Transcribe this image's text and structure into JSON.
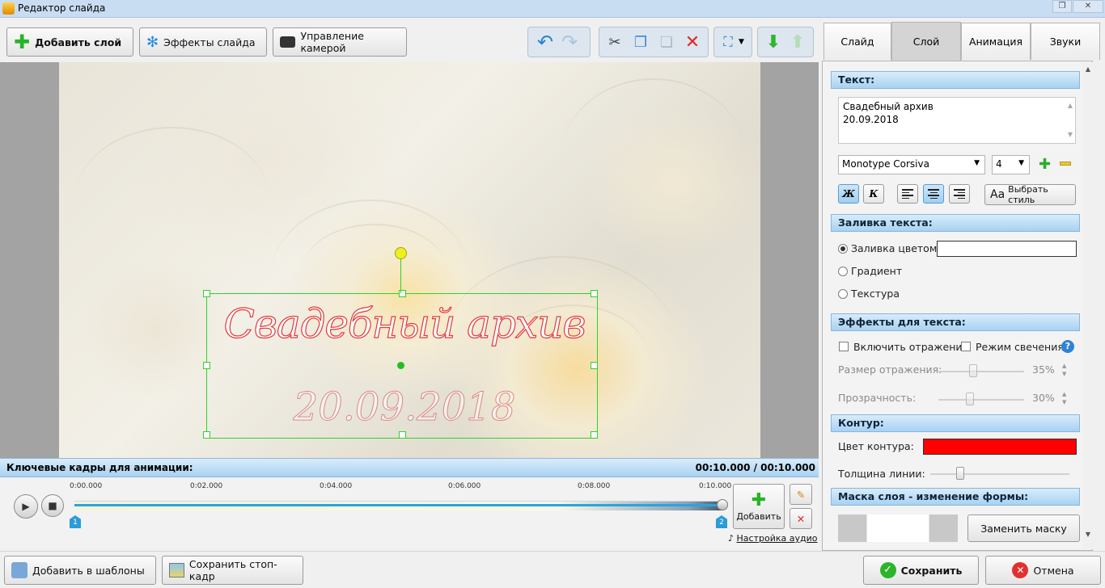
{
  "window": {
    "title": "Редактор слайда"
  },
  "toolbar": {
    "add_layer": "Добавить слой",
    "slide_effects": "Эффекты слайда",
    "camera": "Управление камерой"
  },
  "slide": {
    "line1": "Свадебный архив",
    "line2": "20.09.2018"
  },
  "keyframes": {
    "title": "Ключевые кадры для анимации:",
    "time": "00:10.000 / 00:10.000",
    "ticks": [
      "0:00.000",
      "0:02.000",
      "0:04.000",
      "0:06.000",
      "0:08.000",
      "0:10.000"
    ],
    "marker1": "1",
    "marker2": "2",
    "add": "Добавить",
    "audio_settings": "Настройка аудио"
  },
  "bottom": {
    "add_templates": "Добавить в шаблоны",
    "save_frame": "Сохранить стоп-кадр",
    "save": "Сохранить",
    "cancel": "Отмена"
  },
  "tabs": [
    "Слайд",
    "Слой",
    "Анимация",
    "Звуки"
  ],
  "panel": {
    "text_section": "Текст:",
    "text_line1": "Свадебный архив",
    "text_line2": "20.09.2018",
    "font": "Monotype Corsiva",
    "size": "4",
    "bold": "Ж",
    "italic": "К",
    "choose_style": "Выбрать стиль",
    "fill_section": "Заливка текста:",
    "fill_color": "Заливка цветом",
    "gradient": "Градиент",
    "texture": "Текстура",
    "effects_section": "Эффекты для текста:",
    "reflection": "Включить отражение",
    "glow": "Режим свечения",
    "reflection_size": "Размер отражения:",
    "reflection_size_value": "35%",
    "transparency": "Прозрачность:",
    "transparency_value": "30%",
    "outline_section": "Контур:",
    "outline_color": "Цвет контура:",
    "line_width": "Толщина линии:",
    "mask_section": "Маска слоя - изменение формы:",
    "replace_mask": "Заменить маску"
  },
  "colors": {
    "outline": "#ff0000",
    "fill": "#ffffff",
    "accent": "#2fd12f"
  }
}
